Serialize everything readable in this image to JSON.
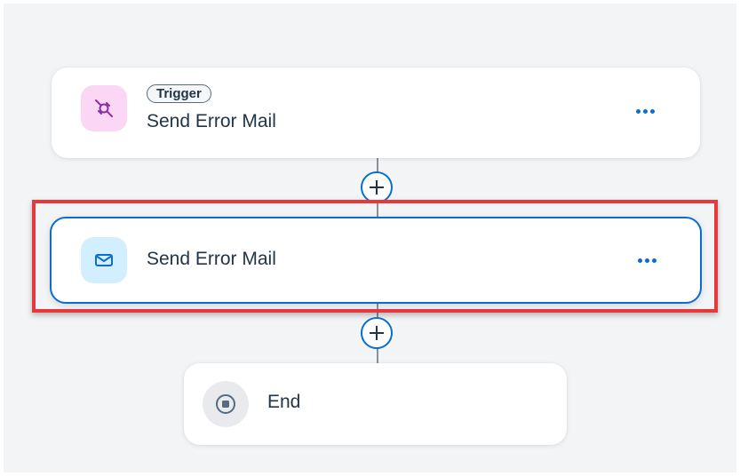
{
  "flow": {
    "steps": [
      {
        "badge": "Trigger",
        "title": "Send Error Mail",
        "icon": "trigger-connection-icon",
        "icon_color": "#8b2ea8",
        "icon_bg": "#fbd7f5"
      },
      {
        "title": "Send Error Mail",
        "icon": "mail-icon",
        "icon_color": "#0a6ed1",
        "icon_bg": "#d1efff",
        "selected": true
      },
      {
        "title": "End",
        "icon": "stop-circle-icon",
        "icon_color": "#556b82",
        "icon_bg": "#e8eaed"
      }
    ],
    "more_icon": "more-horizontal-icon",
    "add_icon": "add-circle-icon"
  },
  "colors": {
    "accent": "#0a6ed1",
    "highlight": "#e5393b",
    "canvas": "#f3f4f6",
    "text": "#223548"
  }
}
